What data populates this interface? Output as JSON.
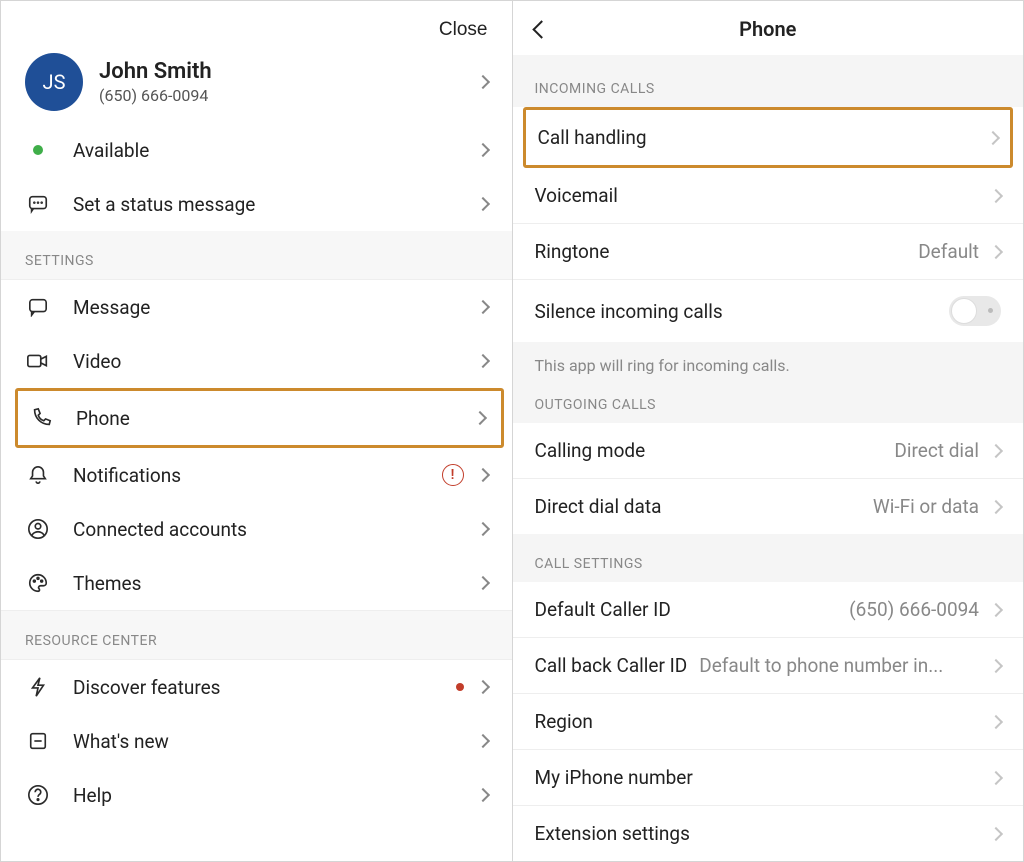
{
  "left": {
    "close": "Close",
    "profile": {
      "initials": "JS",
      "name": "John Smith",
      "phone": "(650) 666-0094"
    },
    "presence": {
      "label": "Available"
    },
    "status": {
      "label": "Set a status message"
    },
    "settings_header": "SETTINGS",
    "settings": {
      "message": "Message",
      "video": "Video",
      "phone": "Phone",
      "notifications": "Notifications",
      "connected": "Connected accounts",
      "themes": "Themes"
    },
    "resource_header": "RESOURCE CENTER",
    "resource": {
      "discover": "Discover features",
      "whatsnew": "What's new",
      "help": "Help"
    }
  },
  "right": {
    "title": "Phone",
    "incoming_header": "INCOMING CALLS",
    "incoming": {
      "call_handling": "Call handling",
      "voicemail": "Voicemail",
      "ringtone": {
        "label": "Ringtone",
        "value": "Default"
      },
      "silence": "Silence incoming calls"
    },
    "silence_note": "This app will ring for incoming calls.",
    "outgoing_header": "OUTGOING CALLS",
    "outgoing": {
      "calling_mode": {
        "label": "Calling mode",
        "value": "Direct dial"
      },
      "direct_dial": {
        "label": "Direct dial data",
        "value": "Wi-Fi or data"
      }
    },
    "call_settings_header": "CALL SETTINGS",
    "call_settings": {
      "default_caller": {
        "label": "Default Caller ID",
        "value": "(650) 666-0094"
      },
      "callback_caller": {
        "label": "Call back Caller ID",
        "value": "Default to phone number in..."
      },
      "region": "Region",
      "my_iphone": "My iPhone number",
      "extension": "Extension settings"
    }
  }
}
